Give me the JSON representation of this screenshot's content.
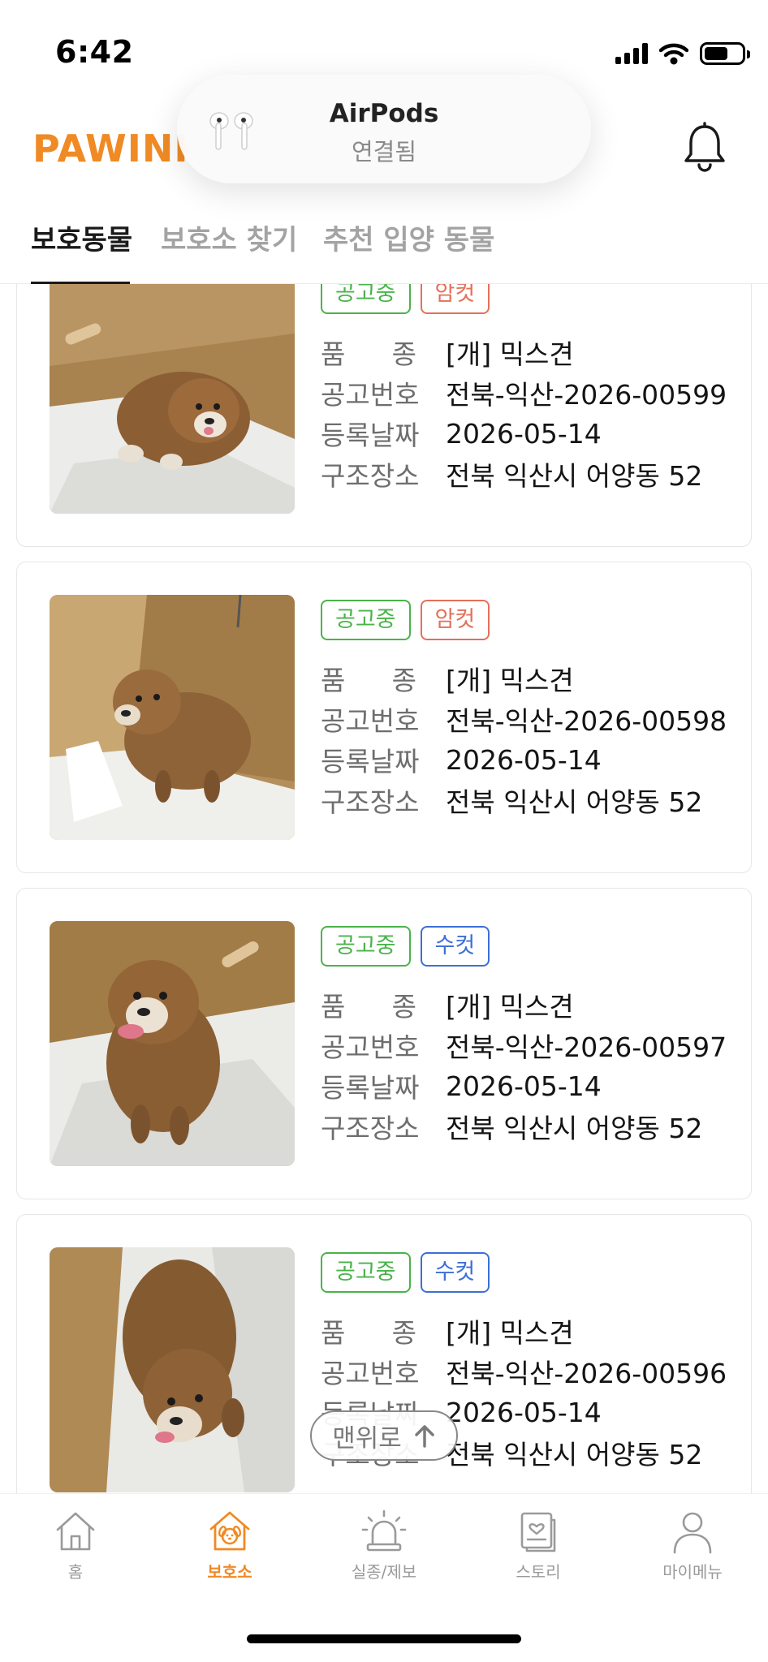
{
  "status_bar": {
    "time": "6:42"
  },
  "header": {
    "logo": "PAWINHAND",
    "bell_icon": "bell-icon"
  },
  "island": {
    "title": "AirPods",
    "subtitle": "연결됨"
  },
  "tabs": [
    {
      "label": "보호동물",
      "active": true
    },
    {
      "label": "보호소 찾기",
      "active": false
    },
    {
      "label": "추천 입양 동물",
      "active": false
    }
  ],
  "field_labels": {
    "breed": [
      "품",
      "종"
    ],
    "notice_no": "공고번호",
    "reg_date": "등록날짜",
    "rescue_place": "구조장소"
  },
  "cards": [
    {
      "status": "공고중",
      "sex": "암컷",
      "sex_type": "female",
      "breed": "[개] 믹스견",
      "notice_no": "전북-익산-2026-00599",
      "reg_date": "2026-05-14",
      "rescue_place": "전북 익산시 어양동 52"
    },
    {
      "status": "공고중",
      "sex": "암컷",
      "sex_type": "female",
      "breed": "[개] 믹스견",
      "notice_no": "전북-익산-2026-00598",
      "reg_date": "2026-05-14",
      "rescue_place": "전북 익산시 어양동 52"
    },
    {
      "status": "공고중",
      "sex": "수컷",
      "sex_type": "male",
      "breed": "[개] 믹스견",
      "notice_no": "전북-익산-2026-00597",
      "reg_date": "2026-05-14",
      "rescue_place": "전북 익산시 어양동 52"
    },
    {
      "status": "공고중",
      "sex": "수컷",
      "sex_type": "male",
      "breed": "[개] 믹스견",
      "notice_no": "전북-익산-2026-00596",
      "reg_date": "2026-05-14",
      "rescue_place": "전북 익산시 어양동 52"
    }
  ],
  "scroll_to_top": {
    "label": "맨위로",
    "icon": "arrow-up-icon"
  },
  "bottom_nav": [
    {
      "label": "홈",
      "icon": "home-icon",
      "active": false
    },
    {
      "label": "보호소",
      "icon": "shelter-icon",
      "active": true
    },
    {
      "label": "실종/제보",
      "icon": "siren-icon",
      "active": false
    },
    {
      "label": "스토리",
      "icon": "story-icon",
      "active": false
    },
    {
      "label": "마이메뉴",
      "icon": "person-icon",
      "active": false
    }
  ],
  "colors": {
    "brand": "#f08a24",
    "status": "#4ab34a",
    "female": "#e4705a",
    "male": "#3d6fd6"
  }
}
